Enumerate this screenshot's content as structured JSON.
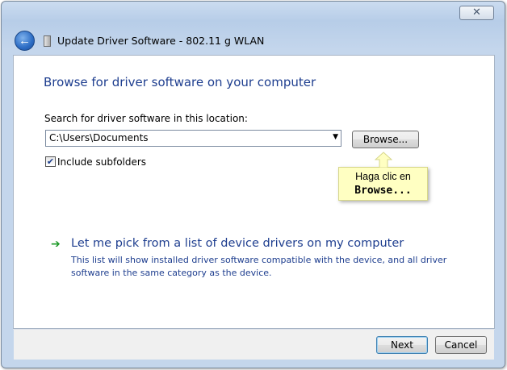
{
  "window": {
    "title": "Update Driver Software - 802.11 g WLAN",
    "close_glyph": "✕"
  },
  "nav": {
    "back_glyph": "←"
  },
  "main": {
    "heading": "Browse for driver software on your computer",
    "search_label": "Search for driver software in this location:",
    "location_value": "C:\\Users\\Documents",
    "dropdown_glyph": "▼",
    "browse_label": "Browse...",
    "include_subfolders": {
      "label": "Include subfolders",
      "checked": true,
      "check_glyph": "✔"
    },
    "callout": {
      "line1": "Haga clic en",
      "line2": "Browse..."
    },
    "pick_option": {
      "arrow_glyph": "➔",
      "title": "Let me pick from a list of device drivers on my computer",
      "description": "This list will show installed driver software compatible with the device, and all driver software in the same category as the device."
    }
  },
  "footer": {
    "next_label": "Next",
    "cancel_label": "Cancel"
  },
  "colors": {
    "link_blue": "#1e3e8f",
    "callout_yellow": "#ffffc2",
    "green_arrow": "#1e9a28",
    "frame_blue": "#b7cde8"
  },
  "icons": [
    "close-icon",
    "back-arrow-icon",
    "device-icon",
    "chevron-down-icon",
    "checkmark-icon",
    "green-arrow-icon"
  ]
}
